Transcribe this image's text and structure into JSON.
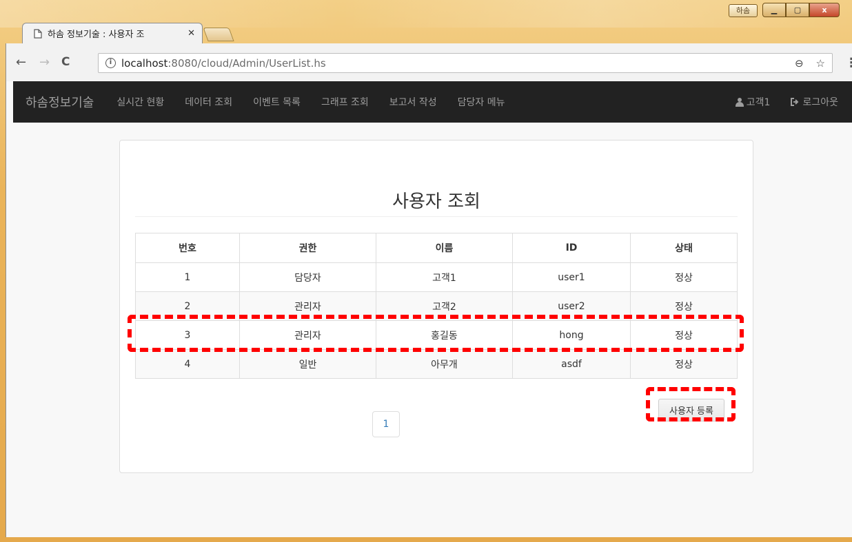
{
  "window": {
    "title_label": "하솜",
    "controls": {
      "minimize": "▁",
      "maximize": "▢",
      "close": "x"
    }
  },
  "tab": {
    "title": "하솜 정보기술 : 사용자 조",
    "close": "✕"
  },
  "address_bar": {
    "info_icon": "i",
    "url_host": "localhost",
    "url_path": ":8080/cloud/Admin/UserList.hs",
    "zoom_icon": "⊖",
    "star_icon": "☆"
  },
  "navbar": {
    "brand": "하솜정보기술",
    "items": [
      "실시간 현황",
      "데이터 조회",
      "이벤트 목록",
      "그래프 조회",
      "보고서 작성",
      "담당자 메뉴"
    ],
    "user": "고객1",
    "logout": "로그아웃"
  },
  "page": {
    "title": "사용자 조회",
    "table": {
      "headers": [
        "번호",
        "권한",
        "이름",
        "ID",
        "상태"
      ],
      "rows": [
        [
          "1",
          "담당자",
          "고객1",
          "user1",
          "정상"
        ],
        [
          "2",
          "관리자",
          "고객2",
          "user2",
          "정상"
        ],
        [
          "3",
          "관리자",
          "홍길동",
          "hong",
          "정상"
        ],
        [
          "4",
          "일반",
          "아무개",
          "asdf",
          "정상"
        ]
      ]
    },
    "register_button": "사용자 등록",
    "pagination": [
      "1"
    ]
  },
  "colors": {
    "navbar_bg": "#222222",
    "annotation": "#ff0000",
    "link": "#337ab7"
  }
}
